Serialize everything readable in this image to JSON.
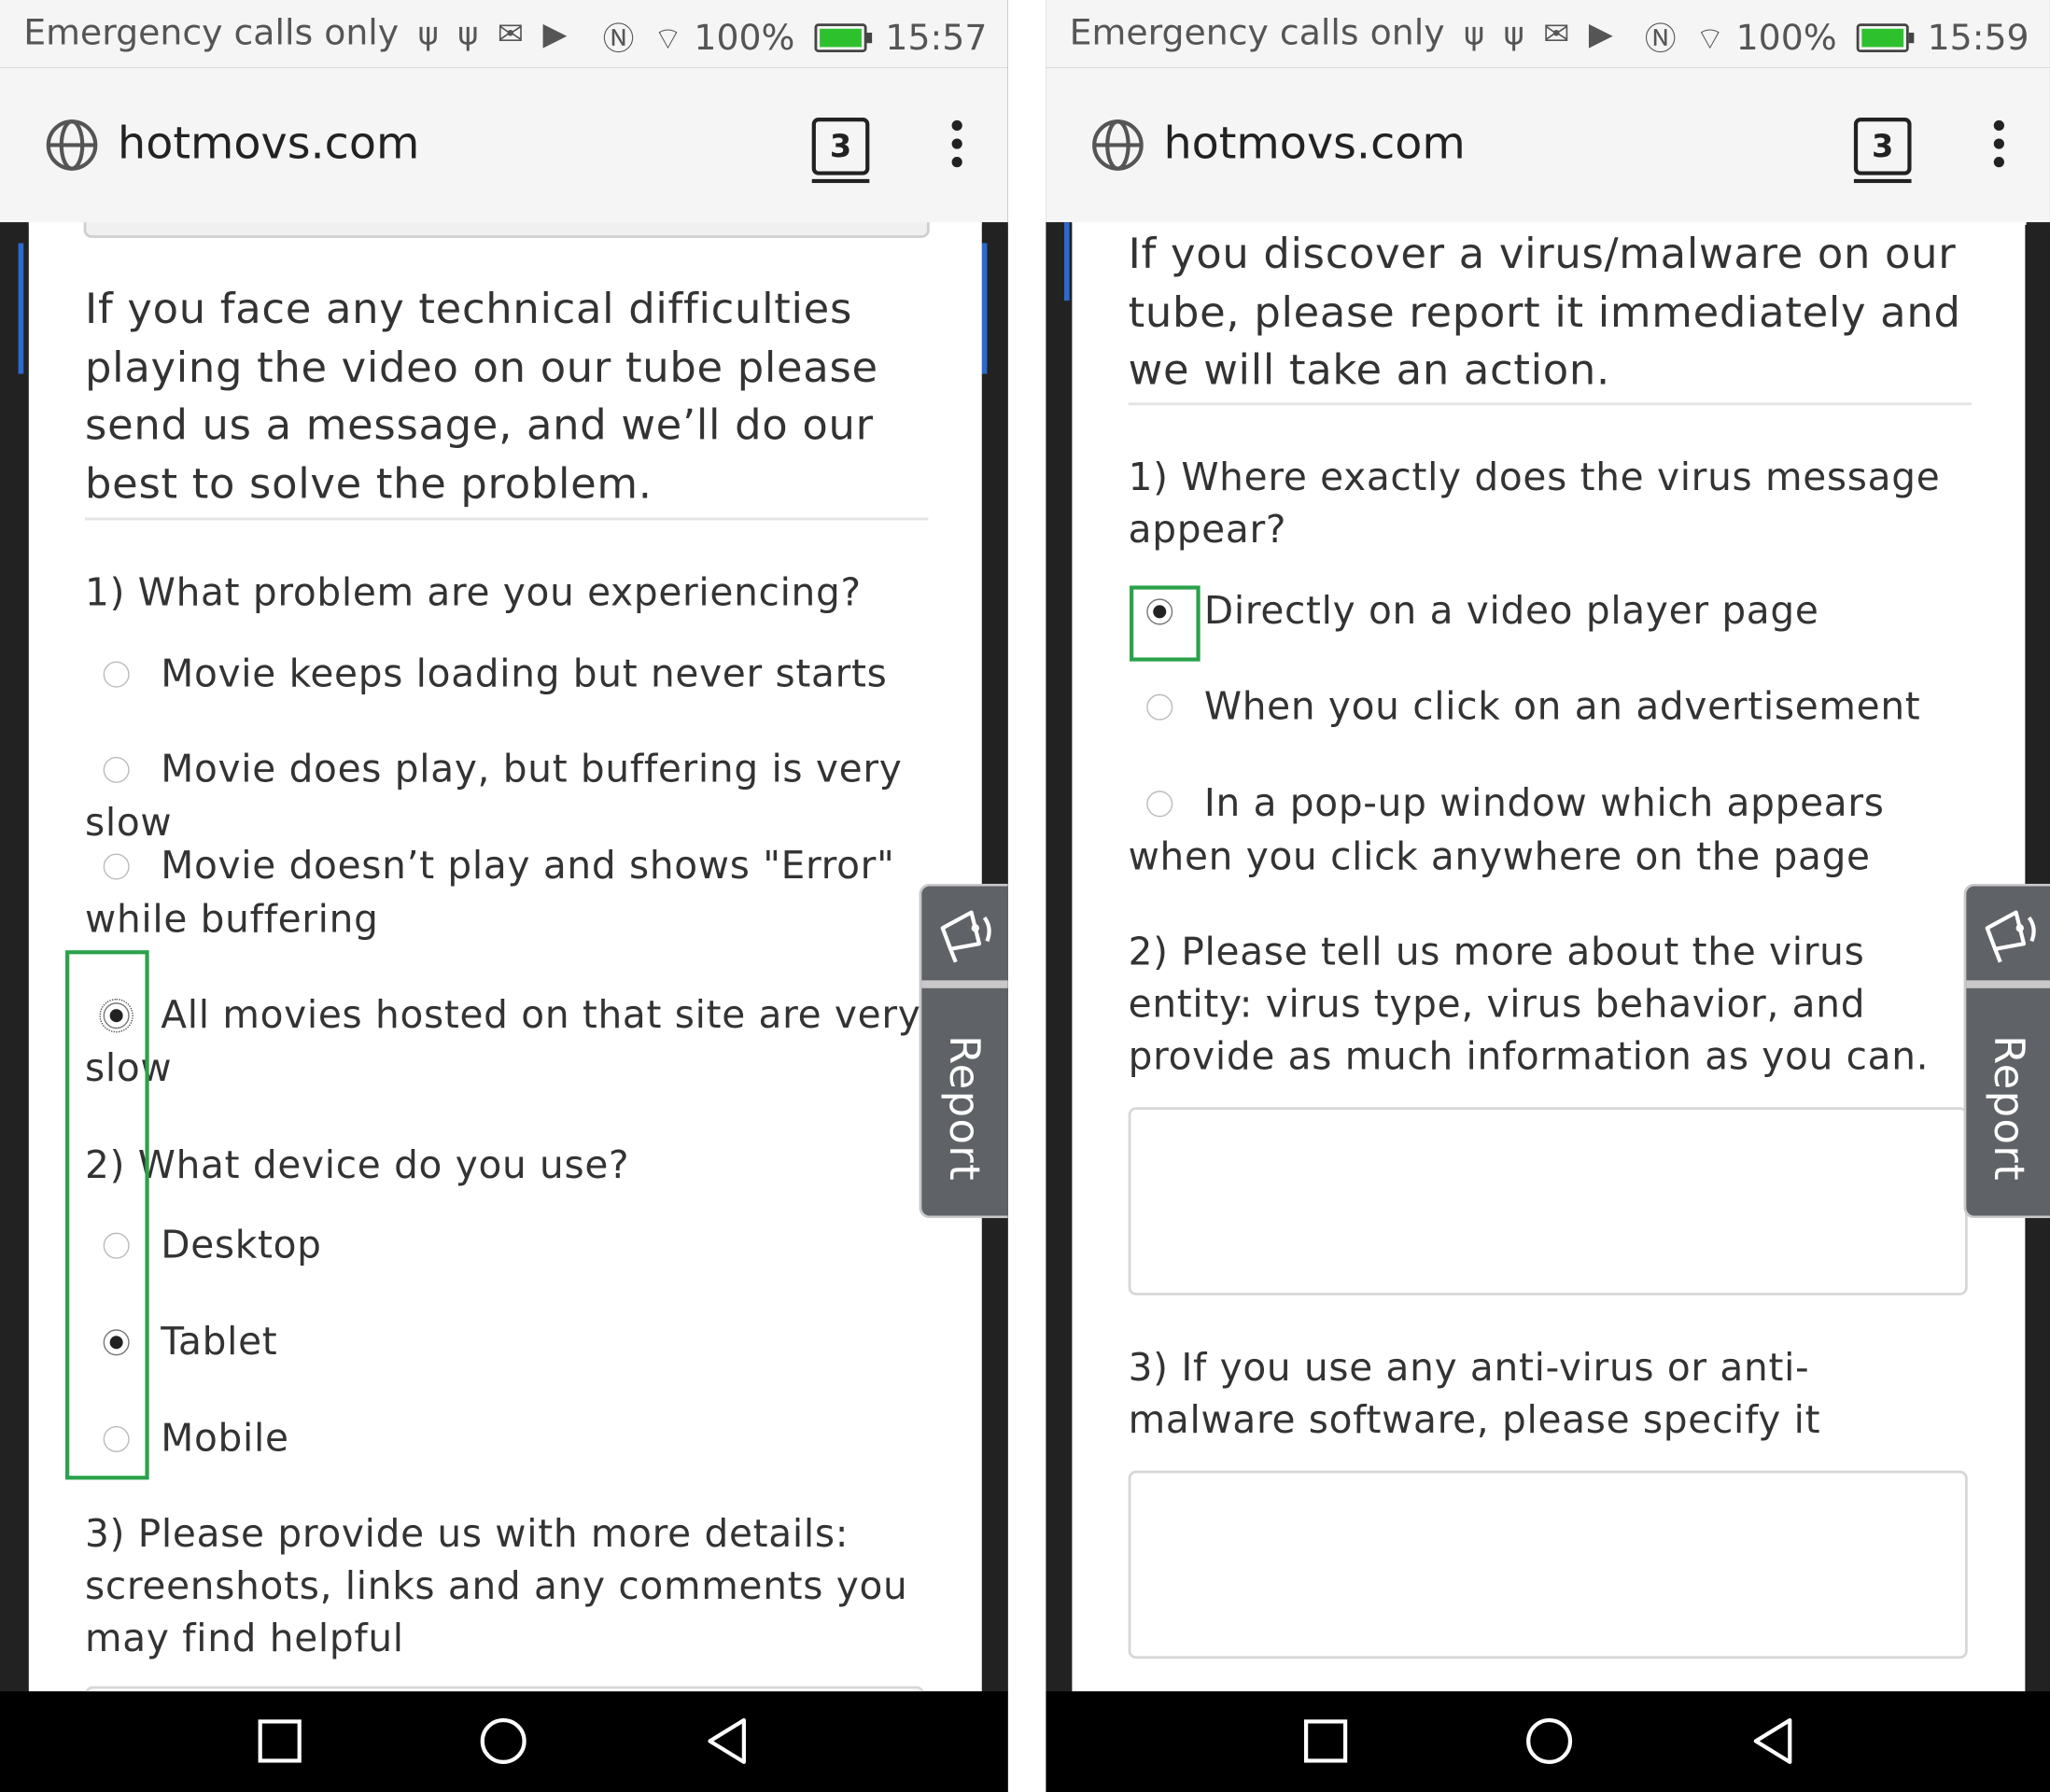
{
  "left": {
    "status": {
      "carrier": "Emergency calls only",
      "battery": "100%",
      "time": "15:57"
    },
    "browser": {
      "url": "hotmovs.com",
      "tab_count": "3"
    },
    "intro": "If you face any technical difficulties playing the video on our tube please send us a message, and we’ll do our best to solve the problem.",
    "q1": "1) What problem are you experiencing?",
    "q1_options": [
      "Movie keeps loading but never starts",
      "Movie does play, but buffering is very slow",
      "Movie doesn’t play and shows \"Error\" while buffering",
      "All movies hosted on that site are very slow"
    ],
    "q1_selected": 3,
    "q2": "2) What device do you use?",
    "q2_options": [
      "Desktop",
      "Tablet",
      "Mobile"
    ],
    "q2_selected": 1,
    "q3": "3) Please provide us with more details: screenshots, links and any comments you may find helpful",
    "report_label": "Report"
  },
  "right": {
    "status": {
      "carrier": "Emergency calls only",
      "battery": "100%",
      "time": "15:59"
    },
    "browser": {
      "url": "hotmovs.com",
      "tab_count": "3"
    },
    "intro": "If you discover a virus/malware on our tube, please report it immediately and we will take an action.",
    "q1": "1) Where exactly does the virus message appear?",
    "q1_options": [
      "Directly on a video player page",
      "When you click on an advertisement",
      "In a pop-up window which appears when you click anywhere on the page"
    ],
    "q1_selected": 0,
    "q2": "2) Please tell us more about the virus entity: virus type, virus behavior, and provide as much information as you can.",
    "q3": "3) If you use any anti-virus or anti-malware software, please specify it",
    "report_label": "Report"
  },
  "colors": {
    "highlight_box": "#2aa24a",
    "battery_fill": "#2ec12e",
    "report_tab": "#5f6266"
  },
  "icons": [
    "usb-icon",
    "mail-icon",
    "play-store-icon",
    "nfc-icon",
    "wifi-icon",
    "battery-icon",
    "globe-icon",
    "tabs-icon",
    "overflow-menu-icon",
    "megaphone-icon",
    "recents-icon",
    "home-icon",
    "back-icon"
  ]
}
